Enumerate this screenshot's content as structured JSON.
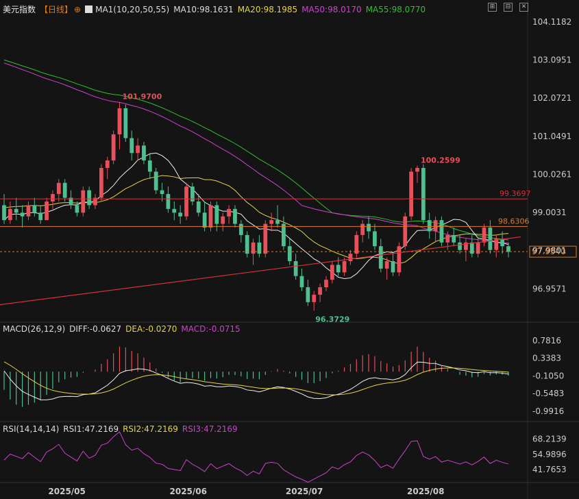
{
  "header": {
    "symbol": "美元指数",
    "period": "【日线】",
    "ma_label": "MA1(10,20,50,55)",
    "ma10": "MA10:98.1631",
    "ma20": "MA20:98.1985",
    "ma50": "MA50:98.0170",
    "ma55": "MA55:98.0770"
  },
  "macd_header": {
    "label": "MACD(26,12,9)",
    "diff": "DIFF:-0.0627",
    "dea": "DEA:-0.0270",
    "macd": "MACD:-0.0715"
  },
  "rsi_header": {
    "label": "RSI(14,14,14)",
    "rsi1": "RSI1:47.2169",
    "rsi2": "RSI2:47.2169",
    "rsi3": "RSI3:47.2169"
  },
  "colors": {
    "bg": "#141414",
    "up": "#e8505b",
    "down": "#4fbf8f",
    "ma10": "#f0f0f0",
    "ma20": "#e6d44a",
    "ma50": "#d040d0",
    "ma55": "#2fc02f",
    "resistance1": "#d9303a",
    "resistance2": "#e07a20",
    "trend": "#d9303a",
    "current": "#e07a20"
  },
  "chart_data": [
    {
      "type": "candlestick",
      "name": "price",
      "y_ticks": [
        "104.1182",
        "103.0951",
        "102.0721",
        "101.0491",
        "100.0261",
        "99.0031",
        "97.9801",
        "96.9571"
      ],
      "x_ticks": [
        "2025/05",
        "2025/06",
        "2025/07",
        "2025/08"
      ],
      "ylim": [
        96.1,
        104.3
      ],
      "annotations": [
        "101.9700",
        "100.2599",
        "96.3729"
      ],
      "levels": {
        "upper": "99.3697",
        "lower": "98.6306",
        "current": "97.9540"
      },
      "ma_last": {
        "ma10": 98.1631,
        "ma20": 98.1985,
        "ma50": 98.017,
        "ma55": 98.077
      },
      "ohlc": [
        [
          99.2,
          99.5,
          98.7,
          98.8
        ],
        [
          98.8,
          99.3,
          98.7,
          99.1
        ],
        [
          99.1,
          99.4,
          98.8,
          99.0
        ],
        [
          99.0,
          99.2,
          98.6,
          98.9
        ],
        [
          98.9,
          99.3,
          98.8,
          99.2
        ],
        [
          99.2,
          99.4,
          98.9,
          99.0
        ],
        [
          99.0,
          99.2,
          98.7,
          98.8
        ],
        [
          98.8,
          99.4,
          98.8,
          99.3
        ],
        [
          99.3,
          99.6,
          99.1,
          99.5
        ],
        [
          99.5,
          99.9,
          99.3,
          99.8
        ],
        [
          99.8,
          99.9,
          99.3,
          99.4
        ],
        [
          99.4,
          99.6,
          99.1,
          99.2
        ],
        [
          99.2,
          99.3,
          98.9,
          99.0
        ],
        [
          99.0,
          99.7,
          98.9,
          99.6
        ],
        [
          99.6,
          99.7,
          99.1,
          99.2
        ],
        [
          99.2,
          99.5,
          99.1,
          99.4
        ],
        [
          99.4,
          100.3,
          99.3,
          100.2
        ],
        [
          100.2,
          100.5,
          99.9,
          100.4
        ],
        [
          100.4,
          101.2,
          100.3,
          101.1
        ],
        [
          101.1,
          101.97,
          100.7,
          101.8
        ],
        [
          101.8,
          101.9,
          100.9,
          101.0
        ],
        [
          101.0,
          101.2,
          100.4,
          100.6
        ],
        [
          100.6,
          101.0,
          100.4,
          100.8
        ],
        [
          100.8,
          100.9,
          100.3,
          100.4
        ],
        [
          100.4,
          100.6,
          99.9,
          100.1
        ],
        [
          100.1,
          100.2,
          99.5,
          99.6
        ],
        [
          99.6,
          99.8,
          99.3,
          99.5
        ],
        [
          99.5,
          99.7,
          99.0,
          99.1
        ],
        [
          99.1,
          99.3,
          98.8,
          99.0
        ],
        [
          99.0,
          99.2,
          98.7,
          98.9
        ],
        [
          98.9,
          99.8,
          98.8,
          99.7
        ],
        [
          99.7,
          99.8,
          99.2,
          99.3
        ],
        [
          99.3,
          99.5,
          98.9,
          99.0
        ],
        [
          99.0,
          99.3,
          98.5,
          98.6
        ],
        [
          98.6,
          99.3,
          98.5,
          99.2
        ],
        [
          99.2,
          99.3,
          98.5,
          98.7
        ],
        [
          98.7,
          99.0,
          98.5,
          98.9
        ],
        [
          98.9,
          99.2,
          98.7,
          99.1
        ],
        [
          99.1,
          99.2,
          98.6,
          98.7
        ],
        [
          98.7,
          98.8,
          98.2,
          98.4
        ],
        [
          98.4,
          98.5,
          97.8,
          97.9
        ],
        [
          97.9,
          98.3,
          97.6,
          98.2
        ],
        [
          98.2,
          98.4,
          97.8,
          97.9
        ],
        [
          97.9,
          98.8,
          97.8,
          98.7
        ],
        [
          98.7,
          99.0,
          98.5,
          98.8
        ],
        [
          98.8,
          99.2,
          98.6,
          98.7
        ],
        [
          98.7,
          98.9,
          98.0,
          98.1
        ],
        [
          98.1,
          98.3,
          97.6,
          97.7
        ],
        [
          97.7,
          97.9,
          97.2,
          97.3
        ],
        [
          97.3,
          97.5,
          96.9,
          97.0
        ],
        [
          97.0,
          97.2,
          96.5,
          96.6
        ],
        [
          96.6,
          96.9,
          96.37,
          96.8
        ],
        [
          96.8,
          97.1,
          96.6,
          97.0
        ],
        [
          97.0,
          97.3,
          96.9,
          97.2
        ],
        [
          97.2,
          97.7,
          97.1,
          97.6
        ],
        [
          97.6,
          97.8,
          97.3,
          97.4
        ],
        [
          97.4,
          97.8,
          97.3,
          97.7
        ],
        [
          97.7,
          98.0,
          97.6,
          97.9
        ],
        [
          97.9,
          98.5,
          97.8,
          98.4
        ],
        [
          98.4,
          98.8,
          98.2,
          98.7
        ],
        [
          98.7,
          98.9,
          98.3,
          98.5
        ],
        [
          98.5,
          98.7,
          98.0,
          98.1
        ],
        [
          98.1,
          98.3,
          97.4,
          97.5
        ],
        [
          97.5,
          97.8,
          97.2,
          97.7
        ],
        [
          97.7,
          97.9,
          97.3,
          97.4
        ],
        [
          97.4,
          98.2,
          97.3,
          98.1
        ],
        [
          98.1,
          99.0,
          98.0,
          98.9
        ],
        [
          98.9,
          100.2,
          98.8,
          100.1
        ],
        [
          100.1,
          100.26,
          99.8,
          100.2
        ],
        [
          100.2,
          100.3,
          98.7,
          98.8
        ],
        [
          98.8,
          99.0,
          98.3,
          98.5
        ],
        [
          98.5,
          98.9,
          98.2,
          98.8
        ],
        [
          98.8,
          98.9,
          98.1,
          98.2
        ],
        [
          98.2,
          98.5,
          98.0,
          98.4
        ],
        [
          98.4,
          98.6,
          98.1,
          98.2
        ],
        [
          98.2,
          98.4,
          97.9,
          98.0
        ],
        [
          98.0,
          98.3,
          97.7,
          98.2
        ],
        [
          98.2,
          98.4,
          97.8,
          97.9
        ],
        [
          97.9,
          98.3,
          97.8,
          98.2
        ],
        [
          98.2,
          98.7,
          98.1,
          98.6
        ],
        [
          98.6,
          98.8,
          97.9,
          98.0
        ],
        [
          98.0,
          98.4,
          97.8,
          98.3
        ],
        [
          98.3,
          98.5,
          97.9,
          98.1
        ],
        [
          98.1,
          98.2,
          97.8,
          97.95
        ]
      ]
    },
    {
      "type": "bar",
      "name": "MACD",
      "y_ticks": [
        "0.7816",
        "0.3383",
        "-0.1050",
        "-0.5483",
        "-0.9916"
      ],
      "ylim": [
        -1.2,
        0.9
      ]
    },
    {
      "type": "line",
      "name": "RSI",
      "y_ticks": [
        "68.2139",
        "54.9896",
        "41.7653"
      ],
      "ylim": [
        33,
        72
      ]
    }
  ]
}
